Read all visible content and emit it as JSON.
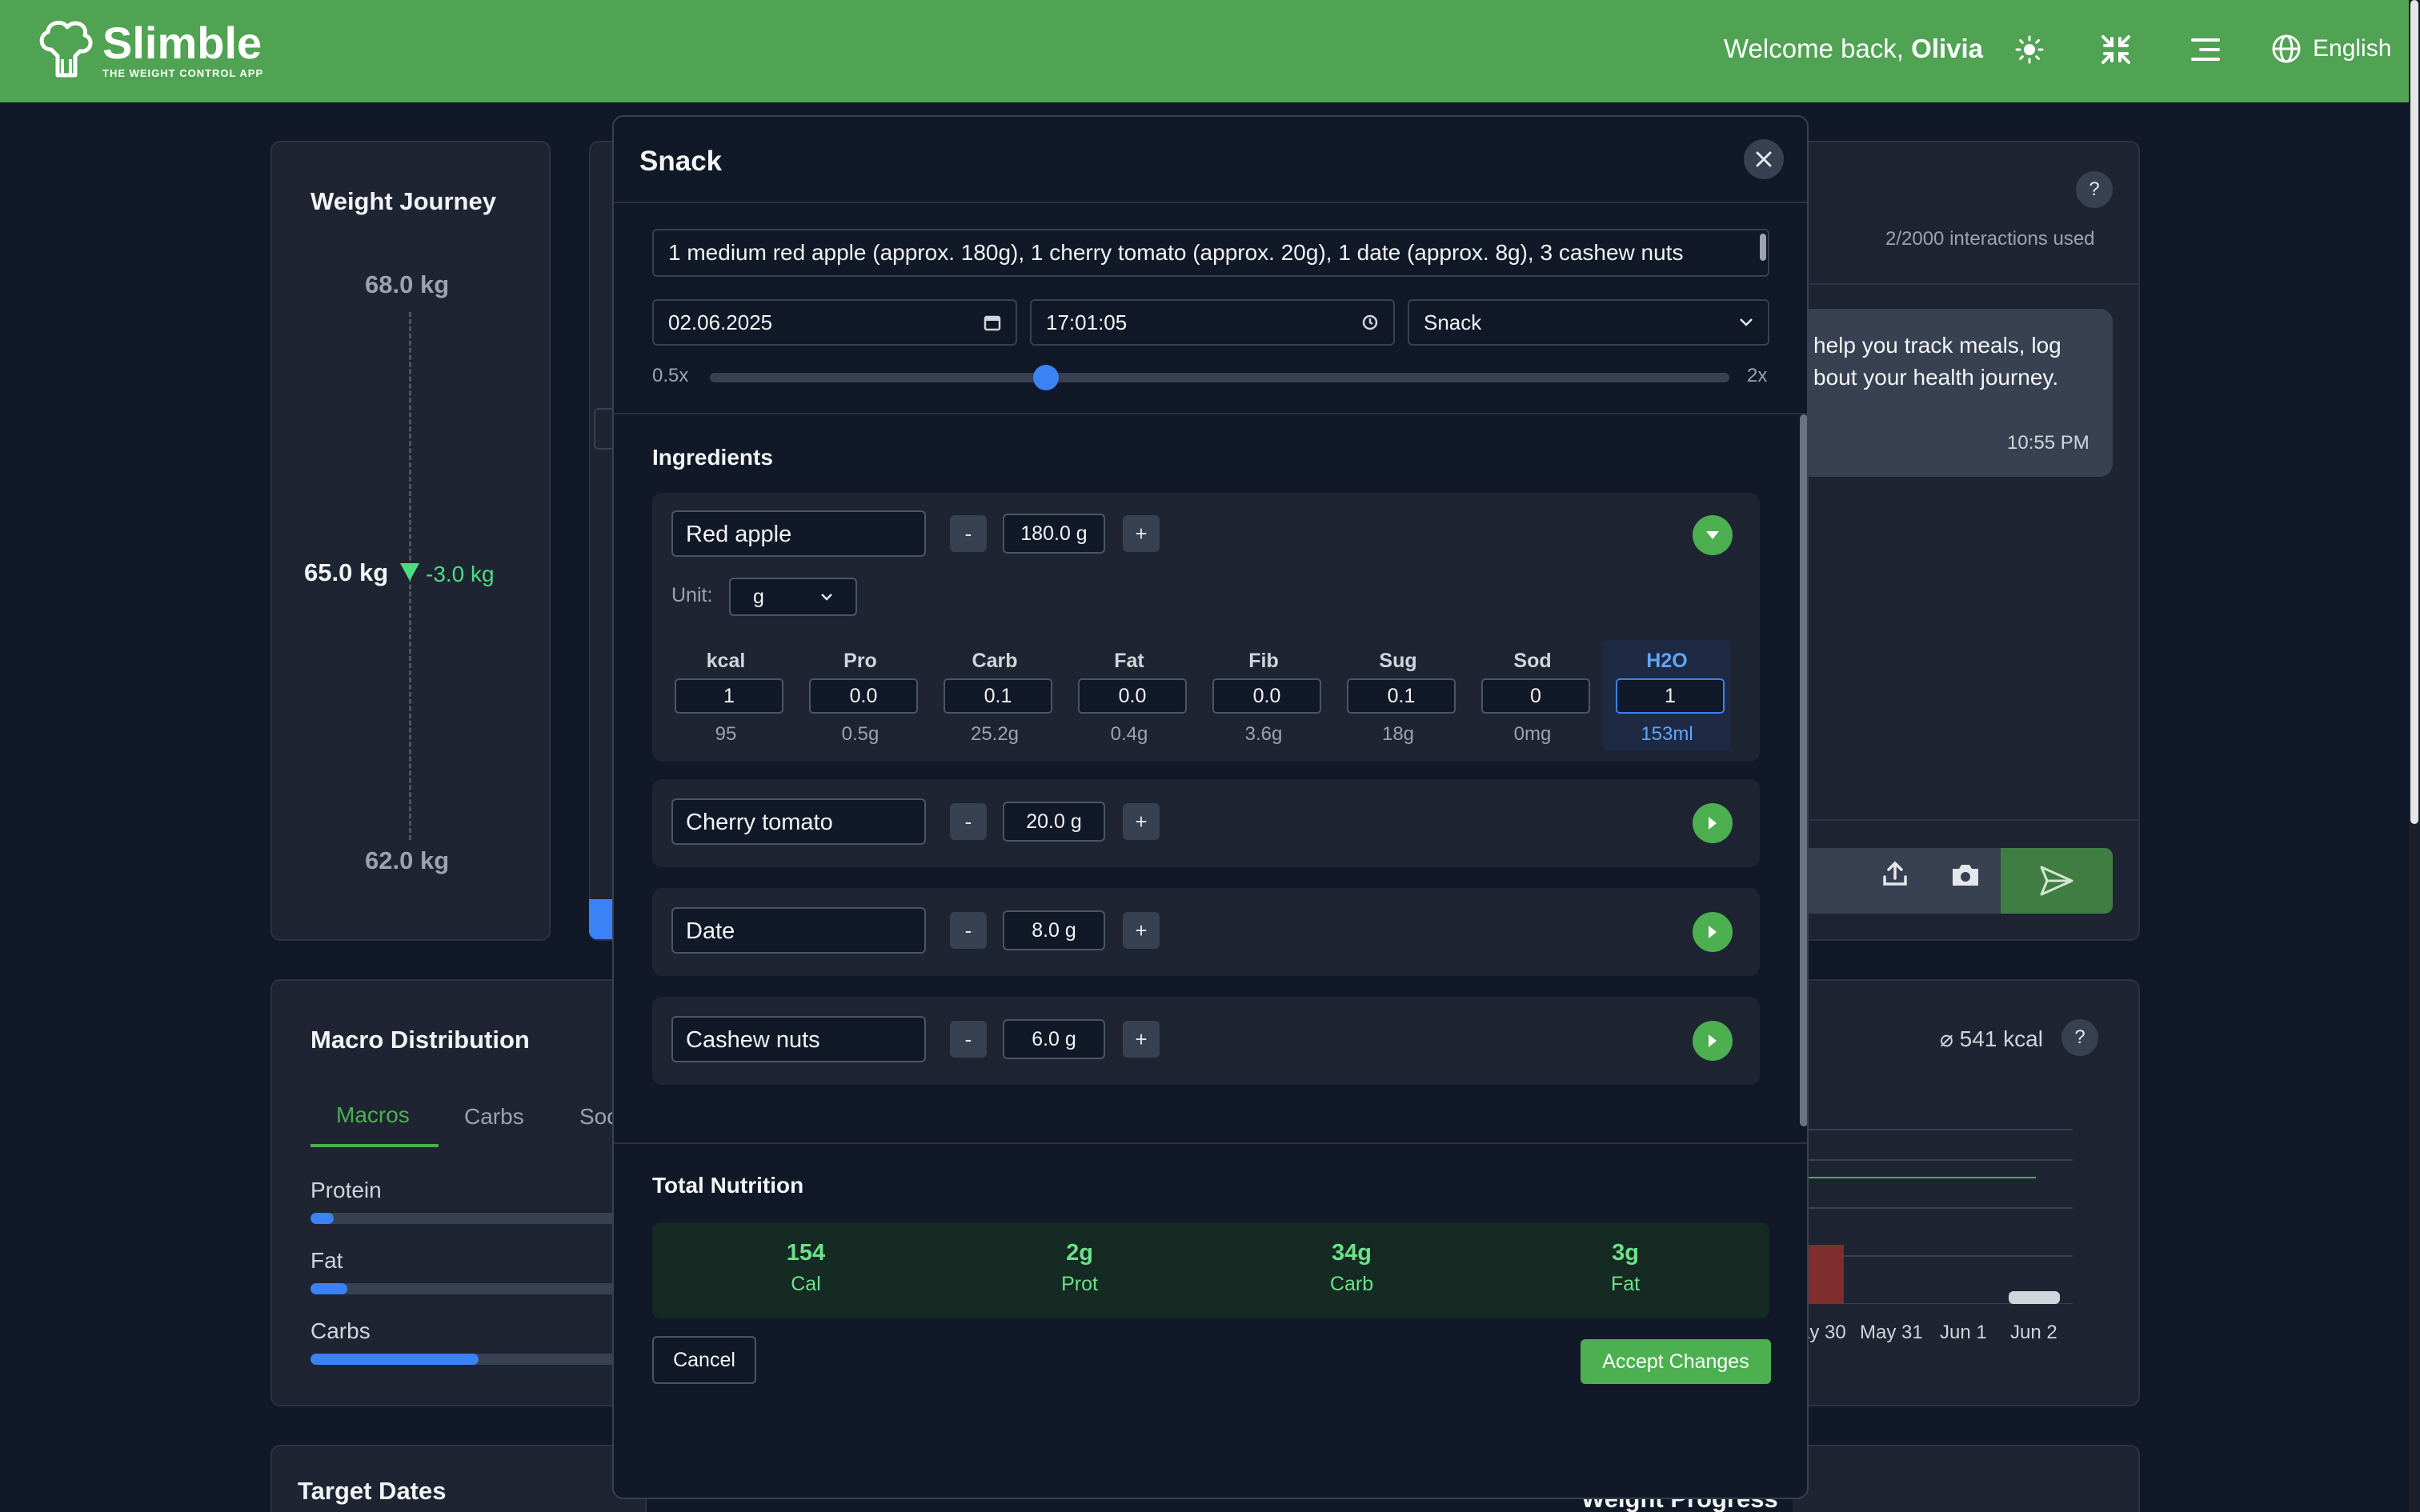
{
  "header": {
    "app_name": "Slimble",
    "tagline": "THE WEIGHT CONTROL APP",
    "welcome_prefix": "Welcome back, ",
    "user_name": "Olivia",
    "language": "English"
  },
  "weight_journey": {
    "title": "Weight Journey",
    "top": "68.0 kg",
    "current": "65.0 kg",
    "change": "-3.0 kg",
    "bottom": "62.0 kg"
  },
  "macro_distribution": {
    "title": "Macro Distribution",
    "tabs": [
      "Macros",
      "Carbs",
      "Soc"
    ],
    "rows": [
      {
        "label": "Protein",
        "fill": 0.07
      },
      {
        "label": "Fat",
        "fill": 0.11
      },
      {
        "label": "Carbs",
        "fill": 0.5
      }
    ]
  },
  "target_dates": {
    "title": "Target Dates"
  },
  "weight_progress": {
    "title": "Weight Progress"
  },
  "chat": {
    "interactions": "2/2000 interactions used",
    "help": "?",
    "message_line1": "help you track meals, log",
    "message_line2": "bout your health journey.",
    "time": "10:55 PM"
  },
  "calorie_chart": {
    "avg": "⌀ 541 kcal",
    "help": "?",
    "dates": [
      "ay 30",
      "May 31",
      "Jun 1",
      "Jun 2"
    ]
  },
  "modal": {
    "title": "Snack",
    "description": "1 medium red apple (approx. 180g), 1 cherry tomato (approx. 20g), 1 date (approx. 8g), 3 cashew nuts",
    "date": "02.06.2025",
    "time": "17:01:05",
    "meal_type": "Snack",
    "slider_min": "0.5x",
    "slider_max": "2x",
    "slider_value": 0.33,
    "ingredients_title": "Ingredients",
    "unit_label": "Unit:",
    "unit_value": "g",
    "minus": "-",
    "plus": "+",
    "ingredients": [
      {
        "name": "Red apple",
        "qty": "180.0 g"
      },
      {
        "name": "Cherry tomato",
        "qty": "20.0 g"
      },
      {
        "name": "Date",
        "qty": "8.0 g"
      },
      {
        "name": "Cashew nuts",
        "qty": "6.0 g"
      }
    ],
    "nutrients": [
      {
        "head": "kcal",
        "input": "1",
        "total": "95"
      },
      {
        "head": "Pro",
        "input": "0.0",
        "total": "0.5g"
      },
      {
        "head": "Carb",
        "input": "0.1",
        "total": "25.2g"
      },
      {
        "head": "Fat",
        "input": "0.0",
        "total": "0.4g"
      },
      {
        "head": "Fib",
        "input": "0.0",
        "total": "3.6g"
      },
      {
        "head": "Sug",
        "input": "0.1",
        "total": "18g"
      },
      {
        "head": "Sod",
        "input": "0",
        "total": "0mg"
      },
      {
        "head": "H2O",
        "input": "1",
        "total": "153ml"
      }
    ],
    "total_title": "Total Nutrition",
    "totals": [
      {
        "value": "154",
        "label": "Cal"
      },
      {
        "value": "2g",
        "label": "Prot"
      },
      {
        "value": "34g",
        "label": "Carb"
      },
      {
        "value": "3g",
        "label": "Fat"
      }
    ],
    "cancel": "Cancel",
    "accept": "Accept Changes"
  },
  "colors": {
    "brand_green": "#4fa352",
    "accent_blue": "#3b82f6",
    "background": "#111827"
  }
}
